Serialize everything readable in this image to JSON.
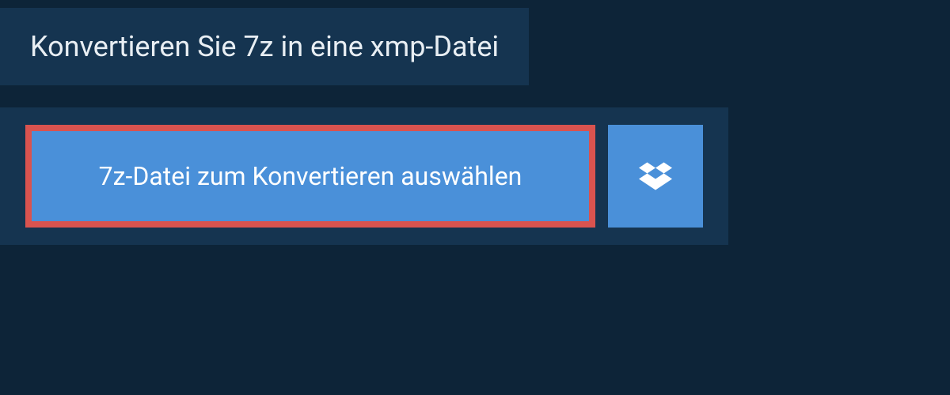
{
  "header": {
    "title": "Konvertieren Sie 7z in eine xmp-Datei"
  },
  "buttons": {
    "select_file_label": "7z-Datei zum Konvertieren auswählen"
  },
  "colors": {
    "background": "#0d2438",
    "panel": "#153450",
    "button": "#4a90d9",
    "highlight_border": "#d9534f"
  }
}
